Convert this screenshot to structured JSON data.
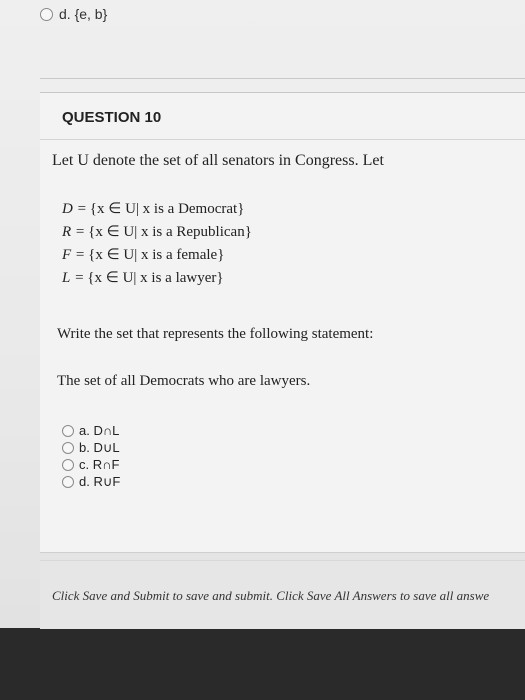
{
  "previous_question": {
    "option_d": "d. {e, b}"
  },
  "question": {
    "title": "QUESTION 10",
    "intro": "Let U denote the set of all senators in Congress. Let",
    "sets": [
      {
        "name": "D",
        "definition": "= {x ∈ U| x is a Democrat}"
      },
      {
        "name": "R",
        "definition": "= {x ∈ U| x is a Republican}"
      },
      {
        "name": "F",
        "definition": "= {x ∈ U| x is a female}"
      },
      {
        "name": "L",
        "definition": "= {x ∈ U| x is a lawyer}"
      }
    ],
    "instruction": "Write the set that represents the following statement:",
    "statement": "The set of all Democrats who are lawyers.",
    "options": [
      {
        "label": "a. D∩L"
      },
      {
        "label": "b. D∪L"
      },
      {
        "label": "c. R∩F"
      },
      {
        "label": "d. R∪F"
      }
    ]
  },
  "footer": {
    "text": "Click Save and Submit to save and submit. Click Save All Answers to save all answe"
  }
}
